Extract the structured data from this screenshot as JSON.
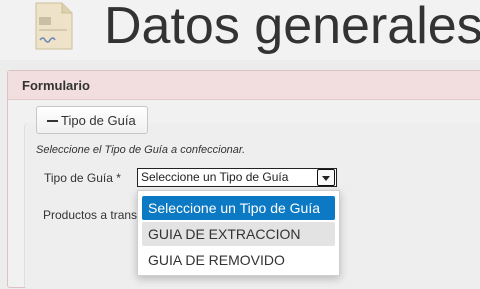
{
  "header": {
    "title": "Datos generales",
    "icon": "document-icon"
  },
  "panel": {
    "title": "Formulario"
  },
  "form": {
    "toggle_button_label": "Tipo de Guía",
    "help_text": "Seleccione el Tipo de Guía a confeccionar.",
    "tipo_guia_label": "Tipo de Guía *",
    "tipo_guia_value": "Seleccione un Tipo de Guía",
    "products_label": "Productos a trans"
  },
  "dropdown": {
    "options": [
      {
        "label": "Seleccione un Tipo de Guía",
        "state": "selected"
      },
      {
        "label": "GUIA DE EXTRACCION",
        "state": "hover"
      },
      {
        "label": "GUIA DE REMOVIDO",
        "state": "normal"
      }
    ]
  },
  "colors": {
    "accent": "#0b79c4",
    "panel_heading": "#f2dede",
    "background": "#ececec"
  }
}
